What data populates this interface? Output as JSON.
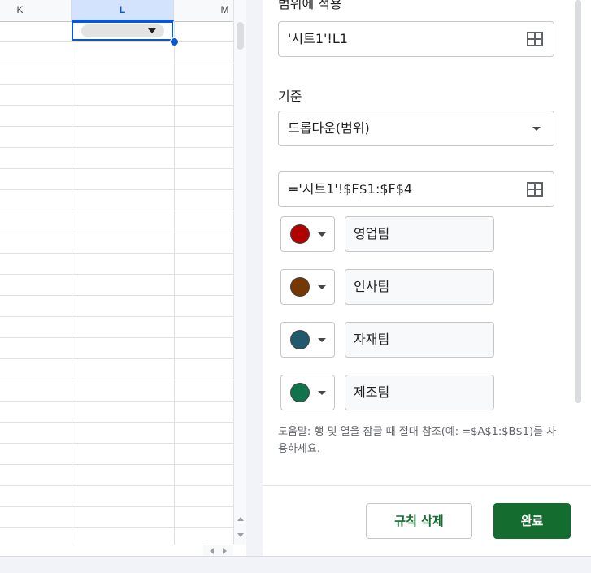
{
  "sheet": {
    "columns": [
      {
        "label": "K",
        "selected": false
      },
      {
        "label": "L",
        "selected": true
      },
      {
        "label": "M",
        "selected": false
      }
    ],
    "selection_color": "#0b57d0"
  },
  "panel": {
    "apply_range_label": "범위에 적용",
    "range_value": "'시트1'!L1",
    "criteria_label": "기준",
    "criteria_value": "드롭다운(범위)",
    "source_range_value": "='시트1'!$F$1:$F$4",
    "items": [
      {
        "label": "영업팀",
        "color": "#b10202"
      },
      {
        "label": "인사팀",
        "color": "#753800"
      },
      {
        "label": "자재팀",
        "color": "#215a6c"
      },
      {
        "label": "제조팀",
        "color": "#11734b"
      }
    ],
    "help_text": "도움말: 행 및 열을 잠글 때 절대 참조(예: =$A$1:$B$1)를 사용하세요.",
    "delete_rule_label": "규칙 삭제",
    "done_label": "완료",
    "accent_color": "#146c2e"
  }
}
